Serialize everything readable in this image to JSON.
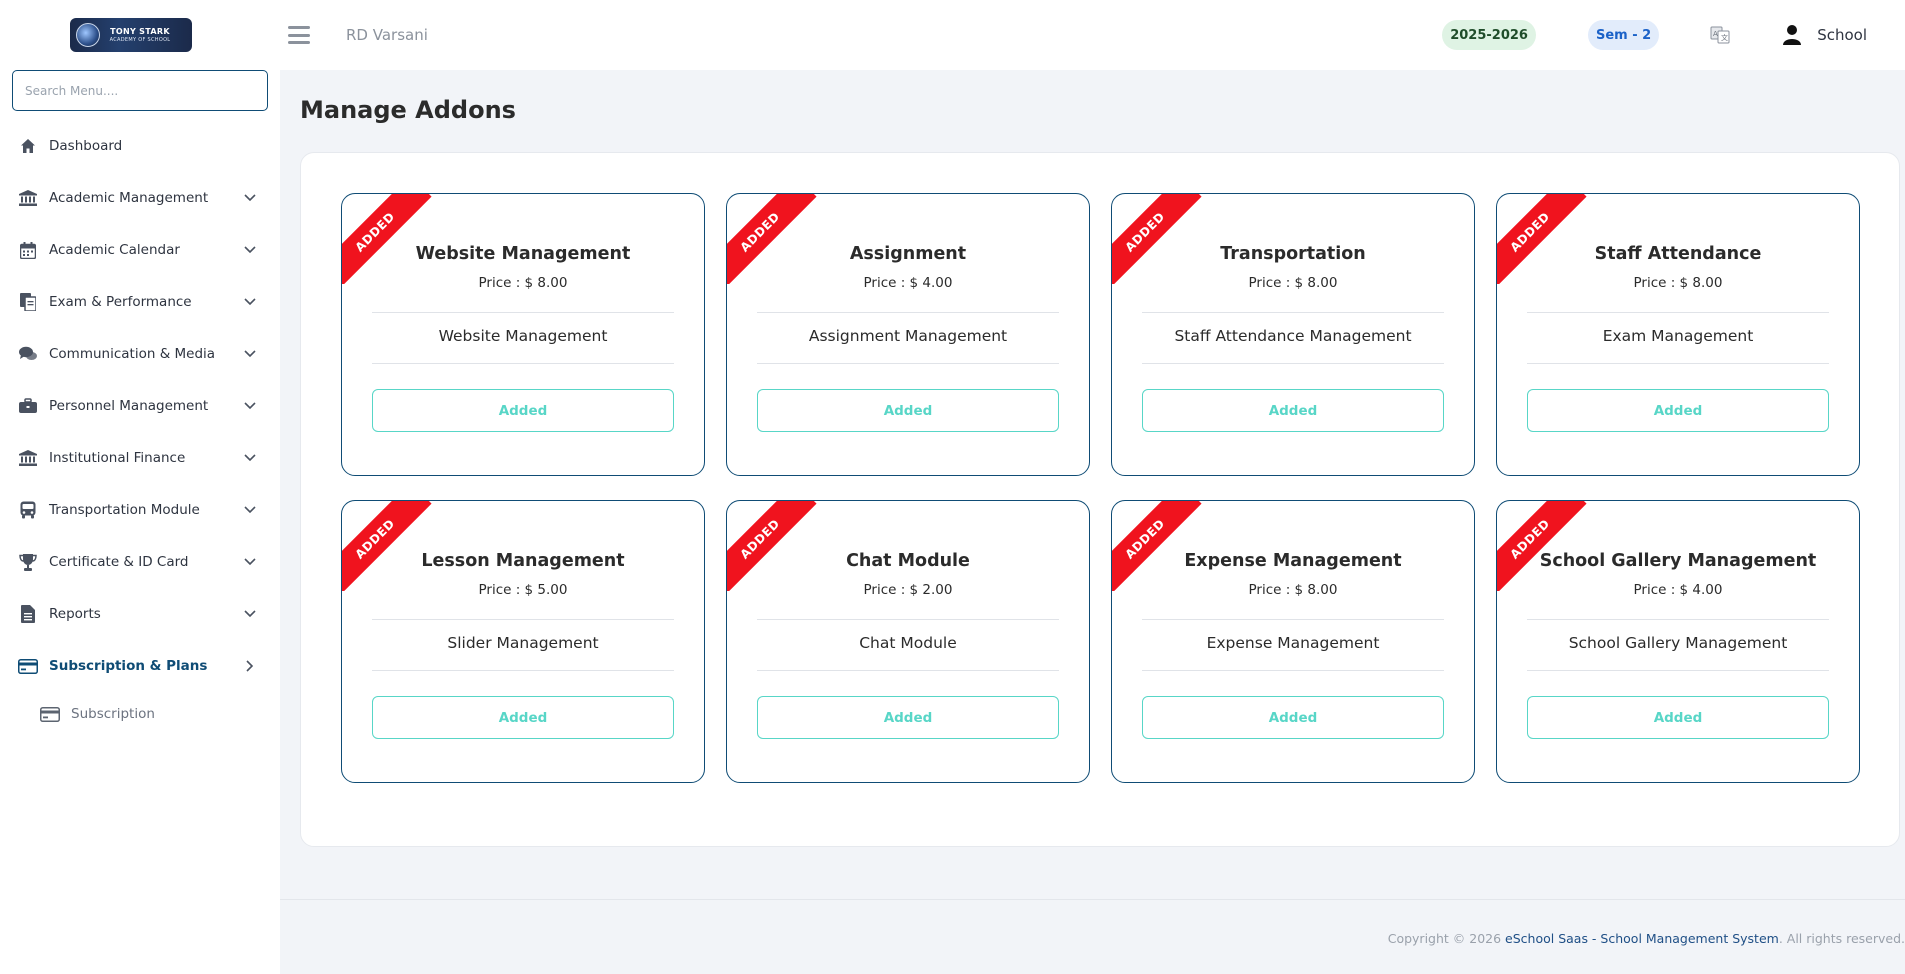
{
  "brand": {
    "logo_line1": "TONY STARK",
    "logo_line2": "ACADEMY OF SCHOOL"
  },
  "sidebar": {
    "search_placeholder": "Search Menu....",
    "items": [
      {
        "label": "Dashboard",
        "icon": "home-icon",
        "has_chevron": false
      },
      {
        "label": "Academic Management",
        "icon": "university-icon",
        "has_chevron": true
      },
      {
        "label": "Academic Calendar",
        "icon": "calendar-icon",
        "has_chevron": true
      },
      {
        "label": "Exam & Performance",
        "icon": "exam-file-icon",
        "has_chevron": true
      },
      {
        "label": "Communication & Media",
        "icon": "chat-icon",
        "has_chevron": true
      },
      {
        "label": "Personnel Management",
        "icon": "briefcase-icon",
        "has_chevron": true
      },
      {
        "label": "Institutional Finance",
        "icon": "bank-icon",
        "has_chevron": true
      },
      {
        "label": "Transportation Module",
        "icon": "bus-icon",
        "has_chevron": true
      },
      {
        "label": "Certificate & ID Card",
        "icon": "trophy-icon",
        "has_chevron": true
      },
      {
        "label": "Reports",
        "icon": "report-icon",
        "has_chevron": true
      },
      {
        "label": "Subscription & Plans",
        "icon": "credit-card-icon",
        "has_chevron": true,
        "active": true
      }
    ],
    "subitems": [
      {
        "label": "Subscription",
        "icon": "credit-card-icon"
      }
    ]
  },
  "header": {
    "user_name": "RD Varsani",
    "session_year": "2025-2026",
    "semester": "Sem - 2",
    "school_label": "School"
  },
  "main": {
    "page_title": "Manage Addons",
    "ribbon_label": "ADDED",
    "button_label": "Added",
    "addons": [
      {
        "title": "Website Management",
        "price": "Price : $ 8.00",
        "description": "Website Management"
      },
      {
        "title": "Assignment",
        "price": "Price : $ 4.00",
        "description": "Assignment Management"
      },
      {
        "title": "Transportation",
        "price": "Price : $ 8.00",
        "description": "Staff Attendance Management"
      },
      {
        "title": "Staff Attendance",
        "price": "Price : $ 8.00",
        "description": "Exam Management"
      },
      {
        "title": "Lesson Management",
        "price": "Price : $ 5.00",
        "description": "Slider Management"
      },
      {
        "title": "Chat Module",
        "price": "Price : $ 2.00",
        "description": "Chat Module"
      },
      {
        "title": "Expense Management",
        "price": "Price : $ 8.00",
        "description": "Expense Management"
      },
      {
        "title": "School Gallery Management",
        "price": "Price : $ 4.00",
        "description": "School Gallery Management"
      }
    ]
  },
  "footer": {
    "prefix": "Copyright © 2026 ",
    "link_text": "eSchool Saas - School Management System",
    "suffix": ". All rights reserved."
  },
  "colors": {
    "accent": "#0f4c75",
    "ribbon": "#f0131e",
    "button_outline": "#58d6c7",
    "year_pill_bg": "#dff3e4",
    "sem_pill_bg": "#e2ecfb"
  }
}
